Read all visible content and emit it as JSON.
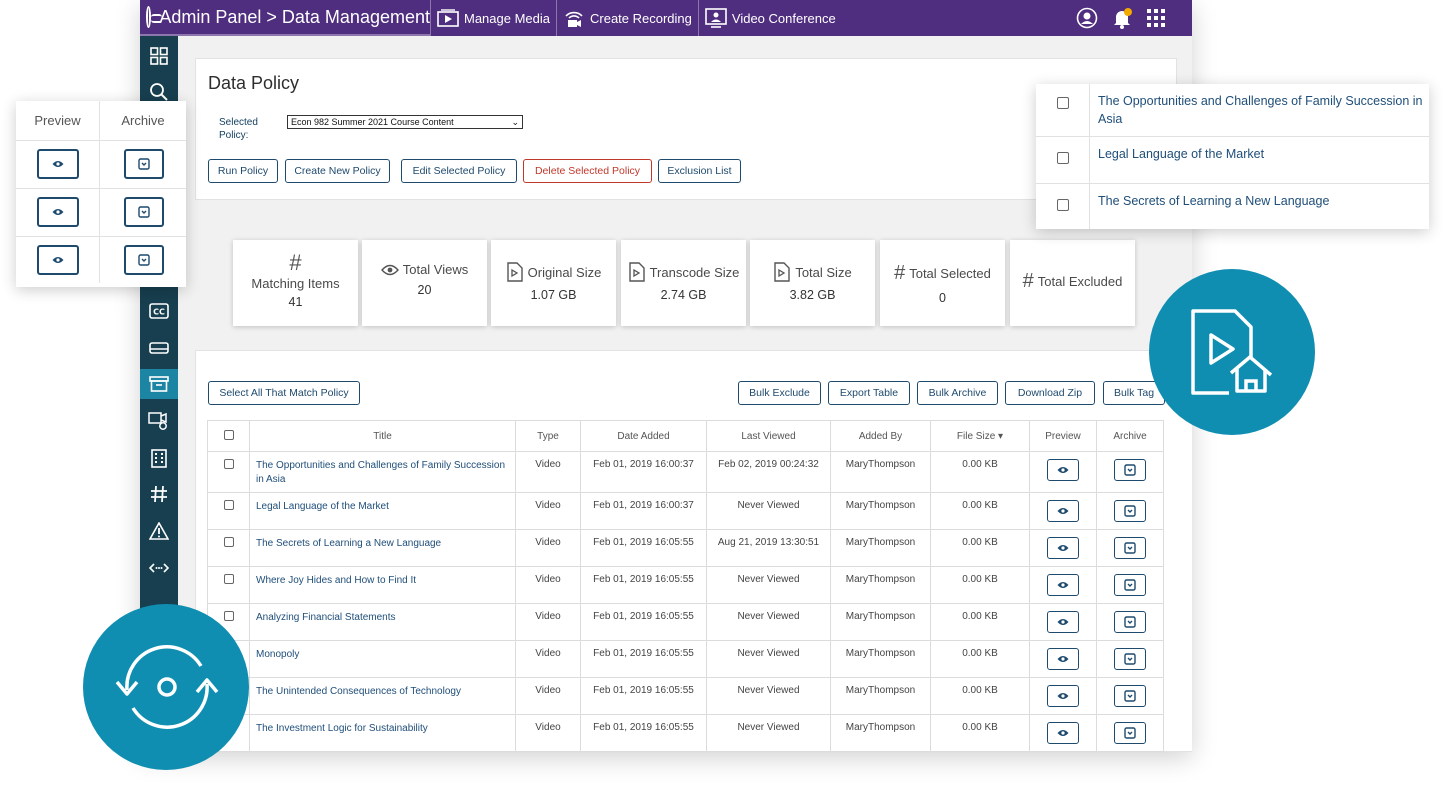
{
  "header": {
    "title": "Admin Panel > Data Management",
    "nav": [
      {
        "label": "Manage Media",
        "icon": "manage-media-icon"
      },
      {
        "label": "Create Recording",
        "icon": "create-recording-icon"
      },
      {
        "label": "Video Conference",
        "icon": "video-conference-icon"
      }
    ]
  },
  "policy": {
    "heading": "Data Policy",
    "selected_label": "Selected Policy:",
    "selected_value": "Econ 982 Summer 2021 Course Content",
    "buttons": {
      "run": "Run Policy",
      "create": "Create New Policy",
      "edit": "Edit Selected Policy",
      "delete": "Delete Selected Policy",
      "exclusion": "Exclusion List"
    }
  },
  "stats": [
    {
      "label": "Matching Items",
      "value": "41",
      "icon": "hash-icon"
    },
    {
      "label": "Total Views",
      "value": "20",
      "icon": "eye-icon"
    },
    {
      "label": "Original Size",
      "value": "1.07 GB",
      "icon": "file-play-icon"
    },
    {
      "label": "Transcode Size",
      "value": "2.74 GB",
      "icon": "file-play-icon"
    },
    {
      "label": "Total Size",
      "value": "3.82 GB",
      "icon": "file-play-icon"
    },
    {
      "label": "Total Selected",
      "value": "0",
      "icon": "hash-icon"
    },
    {
      "label": "Total Excluded",
      "value": "",
      "icon": "hash-icon"
    }
  ],
  "table_actions": {
    "select_all": "Select All That Match Policy",
    "bulk_exclude": "Bulk Exclude",
    "export": "Export Table",
    "bulk_archive": "Bulk Archive",
    "download_zip": "Download Zip",
    "bulk_tag": "Bulk Tag"
  },
  "table": {
    "columns": [
      "Title",
      "Type",
      "Date Added",
      "Last Viewed",
      "Added By",
      "File Size",
      "Preview",
      "Archive"
    ],
    "sort_indicator": "▾",
    "rows": [
      {
        "title": "The Opportunities and Challenges of Family Succession in Asia",
        "type": "Video",
        "date_added": "Feb 01, 2019 16:00:37",
        "last_viewed": "Feb 02, 2019 00:24:32",
        "added_by": "MaryThompson",
        "size": "0.00 KB"
      },
      {
        "title": "Legal Language of the Market",
        "type": "Video",
        "date_added": "Feb 01, 2019 16:00:37",
        "last_viewed": "Never Viewed",
        "added_by": "MaryThompson",
        "size": "0.00 KB"
      },
      {
        "title": "The Secrets of Learning a New Language",
        "type": "Video",
        "date_added": "Feb 01, 2019 16:05:55",
        "last_viewed": "Aug 21, 2019 13:30:51",
        "added_by": "MaryThompson",
        "size": "0.00 KB"
      },
      {
        "title": "Where Joy Hides and How to Find It",
        "type": "Video",
        "date_added": "Feb 01, 2019 16:05:55",
        "last_viewed": "Never Viewed",
        "added_by": "MaryThompson",
        "size": "0.00 KB"
      },
      {
        "title": "Analyzing Financial Statements",
        "type": "Video",
        "date_added": "Feb 01, 2019 16:05:55",
        "last_viewed": "Never Viewed",
        "added_by": "MaryThompson",
        "size": "0.00 KB"
      },
      {
        "title": "Monopoly",
        "type": "Video",
        "date_added": "Feb 01, 2019 16:05:55",
        "last_viewed": "Never Viewed",
        "added_by": "MaryThompson",
        "size": "0.00 KB"
      },
      {
        "title": "The Unintended Consequences of Technology",
        "type": "Video",
        "date_added": "Feb 01, 2019 16:05:55",
        "last_viewed": "Never Viewed",
        "added_by": "MaryThompson",
        "size": "0.00 KB"
      },
      {
        "title": "The Investment Logic for Sustainability",
        "type": "Video",
        "date_added": "Feb 01, 2019 16:05:55",
        "last_viewed": "Never Viewed",
        "added_by": "MaryThompson",
        "size": "0.00 KB"
      }
    ]
  },
  "left_panel": {
    "preview": "Preview",
    "archive": "Archive"
  },
  "right_panel": [
    "The Opportunities and Challenges of Family Succession in Asia",
    "Legal Language of the Market",
    "The Secrets of Learning a New Language"
  ],
  "colors": {
    "topbar": "#4f2d7f",
    "sidebar": "#173f4f",
    "accent": "#0f8eb1",
    "link": "#1f4e79",
    "danger": "#c0392b"
  }
}
